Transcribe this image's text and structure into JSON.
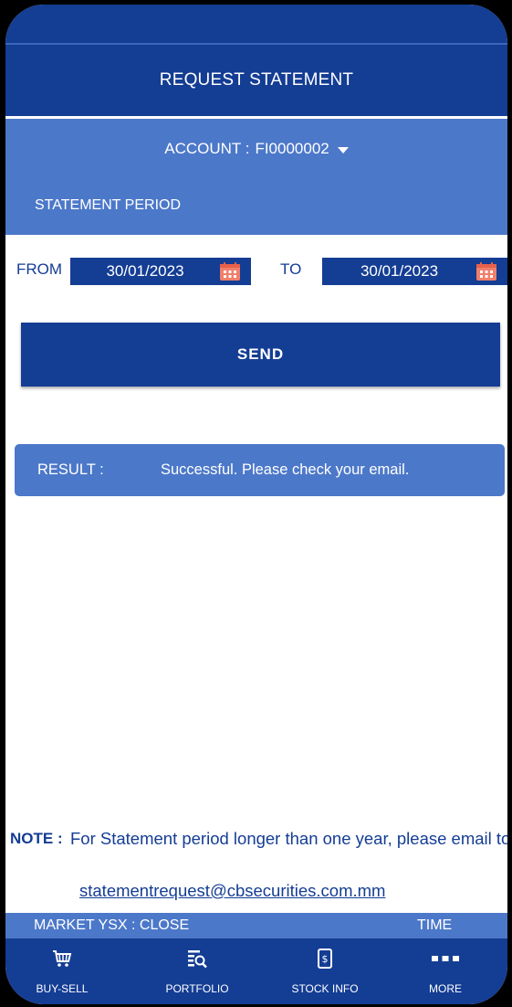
{
  "header": {
    "title": "REQUEST STATEMENT"
  },
  "account": {
    "label": "ACCOUNT :",
    "value": "FI0000002"
  },
  "statement_period": {
    "label": "STATEMENT PERIOD"
  },
  "dates": {
    "from_label": "FROM",
    "from_value": "30/01/2023",
    "to_label": "TO",
    "to_value": "30/01/2023"
  },
  "send": {
    "label": "SEND"
  },
  "result": {
    "label": "RESULT  :",
    "message": "Successful. Please check your email."
  },
  "note": {
    "label": "NOTE :",
    "text": "For Statement period longer than one year, please email to",
    "email": "statementrequest@cbsecurities.com.mm"
  },
  "market": {
    "status": "MARKET YSX : CLOSE",
    "time_label": "TIME"
  },
  "nav": {
    "items": [
      {
        "label": "BUY-SELL",
        "icon": "cart-icon"
      },
      {
        "label": "PORTFOLIO",
        "icon": "portfolio-search-icon"
      },
      {
        "label": "STOCK INFO",
        "icon": "phone-dollar-icon"
      },
      {
        "label": "MORE",
        "icon": "more-dots-icon"
      }
    ]
  },
  "colors": {
    "primary": "#143d94",
    "secondary": "#4c78c9",
    "calendar": "#f07f6b"
  }
}
